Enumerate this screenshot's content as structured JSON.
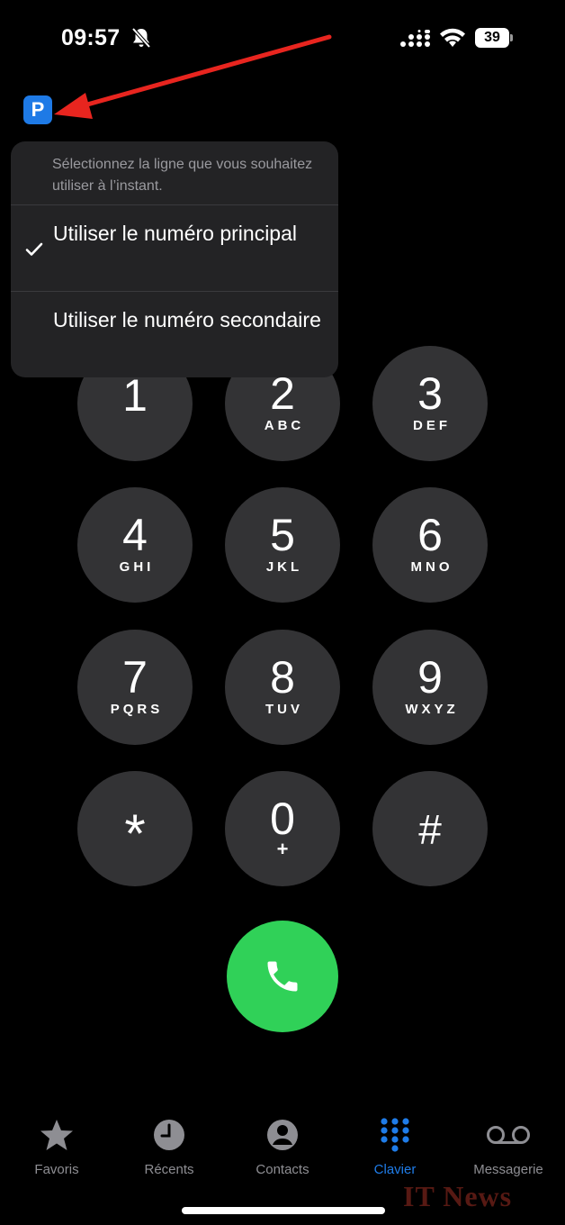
{
  "status_bar": {
    "time": "09:57",
    "battery": "39"
  },
  "line_badge": {
    "letter": "P"
  },
  "line_menu": {
    "header": "Sélectionnez la ligne que vous souhaitez utiliser à l’instant.",
    "options": [
      {
        "label": "Utiliser le numéro principal",
        "selected": true
      },
      {
        "label": "Utiliser le numéro secondaire",
        "selected": false
      }
    ]
  },
  "keypad": {
    "keys": [
      {
        "digit": "1",
        "letters": ""
      },
      {
        "digit": "2",
        "letters": "ABC"
      },
      {
        "digit": "3",
        "letters": "DEF"
      },
      {
        "digit": "4",
        "letters": "GHI"
      },
      {
        "digit": "5",
        "letters": "JKL"
      },
      {
        "digit": "6",
        "letters": "MNO"
      },
      {
        "digit": "7",
        "letters": "PQRS"
      },
      {
        "digit": "8",
        "letters": "TUV"
      },
      {
        "digit": "9",
        "letters": "WXYZ"
      },
      {
        "digit": "*",
        "letters": ""
      },
      {
        "digit": "0",
        "letters": "+"
      },
      {
        "digit": "#",
        "letters": ""
      }
    ]
  },
  "call_button": {
    "icon": "phone-icon",
    "color": "#30d158"
  },
  "tabbar": {
    "active": "Clavier",
    "tabs": [
      {
        "label": "Favoris",
        "icon": "star-icon"
      },
      {
        "label": "Récents",
        "icon": "clock-icon"
      },
      {
        "label": "Contacts",
        "icon": "person-icon"
      },
      {
        "label": "Clavier",
        "icon": "keypad-grid-icon"
      },
      {
        "label": "Messagerie",
        "icon": "voicemail-icon"
      }
    ]
  },
  "annotation": {
    "arrow_color": "#e8251f"
  },
  "watermark": "IT News",
  "colors": {
    "accent": "#1f7ce8",
    "key_bg": "#333335",
    "menu_bg": "#232325"
  }
}
